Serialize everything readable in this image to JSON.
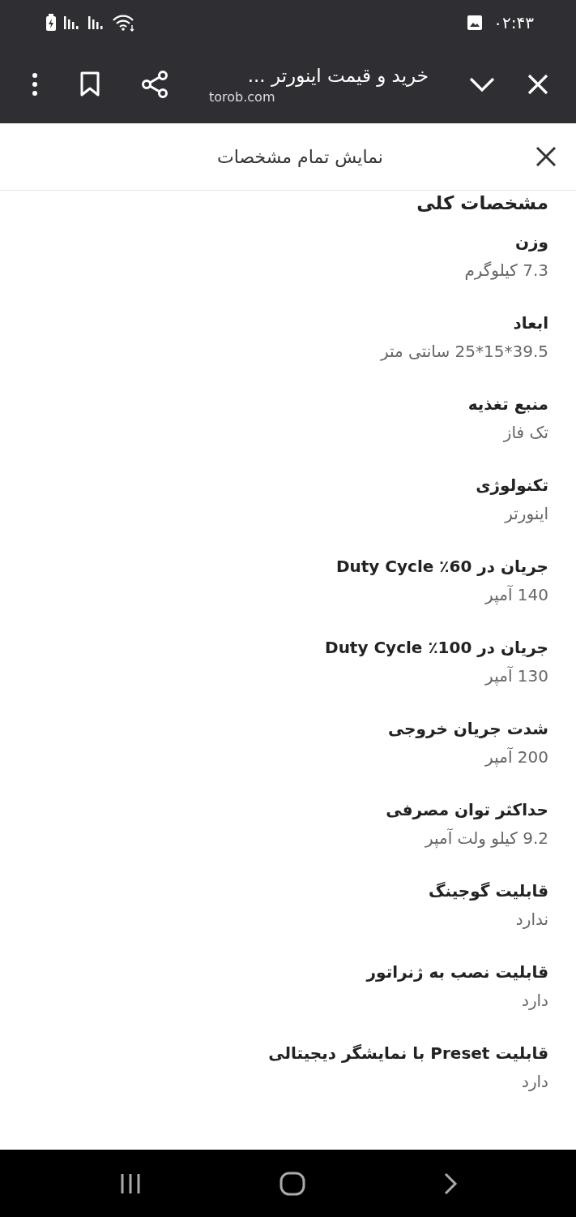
{
  "status_bar": {
    "time": "۰۲:۴۳"
  },
  "browser_toolbar": {
    "title": "خرید و قیمت اینورتر ...",
    "url": "torob.com"
  },
  "sheet": {
    "title": "نمایش تمام مشخصات"
  },
  "section": {
    "title": "مشخصات کلی",
    "specs": [
      {
        "label": "وزن",
        "value": "7.3 کیلوگرم"
      },
      {
        "label": "ابعاد",
        "value": "39.5*15*25 سانتی متر"
      },
      {
        "label": "منبع تغذیه",
        "value": "تک فاز"
      },
      {
        "label": "تکنولوژی",
        "value": "اینورتر"
      },
      {
        "label": "جریان در Duty Cycle ٪60",
        "value": "140 آمپر"
      },
      {
        "label": "جریان در Duty Cycle ٪100",
        "value": "130 آمپر"
      },
      {
        "label": "شدت جریان خروجی",
        "value": "200 آمپر"
      },
      {
        "label": "حداکثر توان مصرفی",
        "value": "9.2 کیلو ولت آمپر"
      },
      {
        "label": "قابلیت گوجینگ",
        "value": "ندارد"
      },
      {
        "label": "قابلیت نصب به ژنراتور",
        "value": "دارد"
      },
      {
        "label": "قابلیت Preset با نمایشگر دیجیتالی",
        "value": "دارد"
      }
    ]
  }
}
